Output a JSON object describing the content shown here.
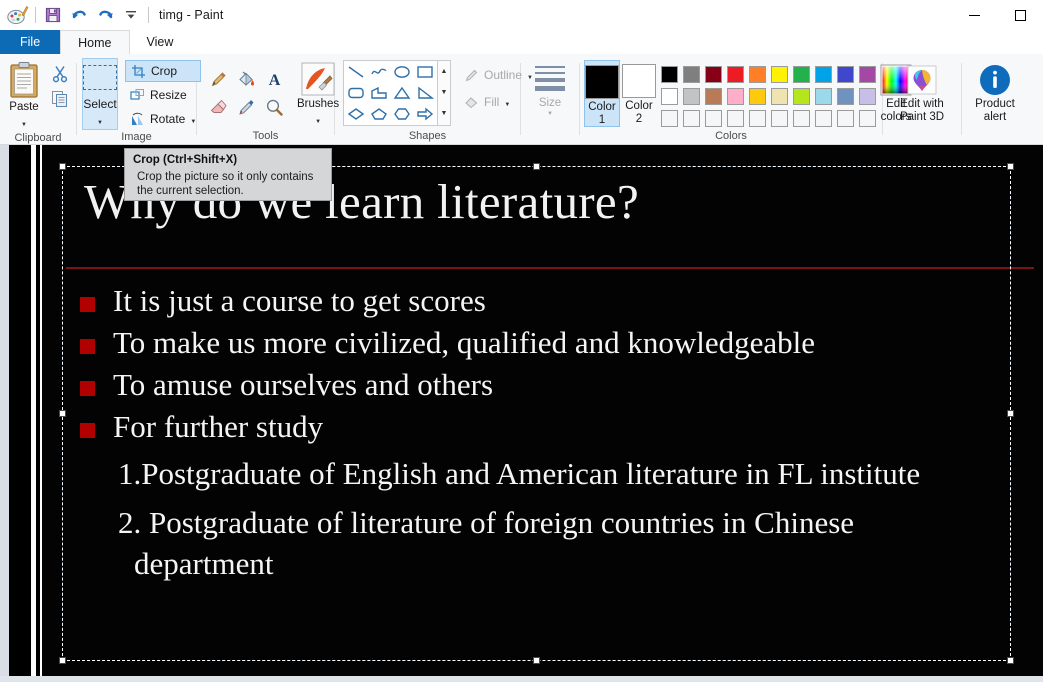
{
  "window": {
    "title": "timg - Paint",
    "app_icon": "paint-logo-icon",
    "quick_access": [
      {
        "name": "save-icon",
        "label": "Save"
      },
      {
        "name": "undo-icon",
        "label": "Undo"
      },
      {
        "name": "redo-icon",
        "label": "Redo"
      },
      {
        "name": "customize-qat-icon",
        "label": "Customize Quick Access Toolbar"
      }
    ],
    "controls": [
      {
        "name": "minimize-button",
        "label": "Minimize"
      },
      {
        "name": "maximize-button",
        "label": "Maximize"
      }
    ]
  },
  "tabs": [
    {
      "label": "File",
      "state": "file"
    },
    {
      "label": "Home",
      "state": "active"
    },
    {
      "label": "View",
      "state": "normal"
    }
  ],
  "ribbon": {
    "groups": [
      {
        "label": "Clipboard",
        "paste_label": "Paste",
        "items": [
          {
            "name": "cut-icon",
            "label": "Cut"
          },
          {
            "name": "copy-icon",
            "label": "Copy"
          }
        ]
      },
      {
        "label": "Image",
        "select_label": "Select",
        "items": [
          {
            "name": "crop-button",
            "label": "Crop",
            "selected": true
          },
          {
            "name": "resize-button",
            "label": "Resize",
            "selected": false
          },
          {
            "name": "rotate-button",
            "label": "Rotate",
            "selected": false
          }
        ]
      },
      {
        "label": "Tools",
        "brushes_label": "Brushes",
        "tools": [
          {
            "name": "pencil-icon",
            "label": "Pencil"
          },
          {
            "name": "fill-with-color-icon",
            "label": "Fill with color"
          },
          {
            "name": "text-icon",
            "label": "Text"
          },
          {
            "name": "eraser-icon",
            "label": "Eraser"
          },
          {
            "name": "color-picker-icon",
            "label": "Color picker"
          },
          {
            "name": "magnifier-icon",
            "label": "Magnifier"
          }
        ]
      },
      {
        "label": "Shapes",
        "shapes": [
          "line-shape",
          "curve-shape",
          "oval-shape",
          "rectangle-shape",
          "rounded-rectangle-shape",
          "polygon-shape",
          "triangle-shape",
          "right-triangle-shape",
          "diamond-shape",
          "pentagon-shape",
          "hexagon-shape",
          "right-arrow-shape"
        ],
        "outline_label": "Outline",
        "fill_label": "Fill",
        "outline_disabled": true,
        "fill_disabled": true
      },
      {
        "label": "Size",
        "disabled": true
      },
      {
        "label": "Colors",
        "color1_label": "Color 1",
        "color2_label": "Color 2",
        "color1_value": "#000000",
        "color2_value": "#ffffff",
        "color1_active": true,
        "edit_colors_label": "Edit colors",
        "palette_row1": [
          "#000000",
          "#7f7f7f",
          "#880015",
          "#ed1c24",
          "#ff7f27",
          "#fff200",
          "#22b14c",
          "#00a2e8",
          "#3f48cc",
          "#a349a4"
        ],
        "palette_row2": [
          "#ffffff",
          "#c3c3c3",
          "#b97a57",
          "#ffaec9",
          "#ffc90e",
          "#efe4b0",
          "#b5e61d",
          "#99d9ea",
          "#7092be",
          "#c8bfe7"
        ],
        "palette_row3": [
          "",
          "",
          "",
          "",
          "",
          "",
          "",
          "",
          "",
          ""
        ]
      }
    ],
    "right_buttons": [
      {
        "name": "edit-with-paint3d-button",
        "label_line1": "Edit with",
        "label_line2": "Paint 3D"
      },
      {
        "name": "product-alert-button",
        "label_line1": "Product",
        "label_line2": "alert",
        "badge": "i"
      }
    ]
  },
  "tooltip": {
    "title": "Crop (Ctrl+Shift+X)",
    "body_line1": "Crop the picture so it only contains",
    "body_line2": "the current selection."
  },
  "canvas": {
    "slide": {
      "title": "Why do we learn literature?",
      "rule_color": "#7a1414",
      "bullet_color": "#b00000",
      "background": "#030303",
      "text_color": "#f5f5f5",
      "bullets": [
        "It is just a course to get scores",
        "To make us more civilized, qualified   and knowledgeable",
        "To amuse ourselves and others",
        "For further study"
      ],
      "numbered": [
        "1.Postgraduate of English and American literature in FL institute",
        "2. Postgraduate of literature of foreign countries in Chinese department"
      ]
    },
    "selection": {
      "name": "selection-marquee",
      "handles": [
        "top-left",
        "top-middle",
        "top-right",
        "middle-left",
        "middle-right",
        "bottom-left",
        "bottom-middle",
        "bottom-right"
      ]
    }
  }
}
